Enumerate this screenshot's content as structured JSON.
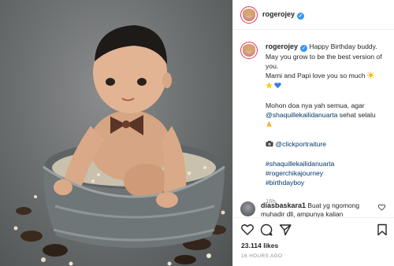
{
  "post": {
    "author": "rogerojey",
    "caption_author": "rogerojey",
    "caption_lines": [
      "Happy Birthday buddy.",
      "May you grow to be the best version of you.",
      "Mami and Papi love you so much"
    ],
    "prayer_line": "Mohon doa nya yah semua, agar",
    "mention_shaquille": "@shaquillekailidanuarta",
    "prayer_tail": "sehat selalu",
    "photo_credit": "@clickportraiture",
    "hashtags": [
      "#shaquillekailidanuarta",
      "#rogerchikajourney",
      "#birthdayboy"
    ],
    "caption_time": "16h",
    "likes": "23.114 likes",
    "posted_time": "16 HOURS AGO"
  },
  "comment": {
    "author": "diasbaskara1",
    "text": "Buat yg ngomong muhadir dll, ampunya kalian"
  },
  "icons": {
    "verified": "verified-badge-icon",
    "like": "heart-icon",
    "comment": "comment-icon",
    "share": "share-icon",
    "save": "bookmark-icon",
    "camera": "camera-emoji-icon",
    "sun": "sun-emoji-icon",
    "star": "star-emoji-icon",
    "blue_heart": "blue-heart-emoji-icon",
    "pray": "pray-emoji-icon"
  },
  "colors": {
    "link": "#00376b",
    "verified": "#3897f0",
    "muted": "#8e8e8e",
    "story_ring": "#e1306c"
  }
}
